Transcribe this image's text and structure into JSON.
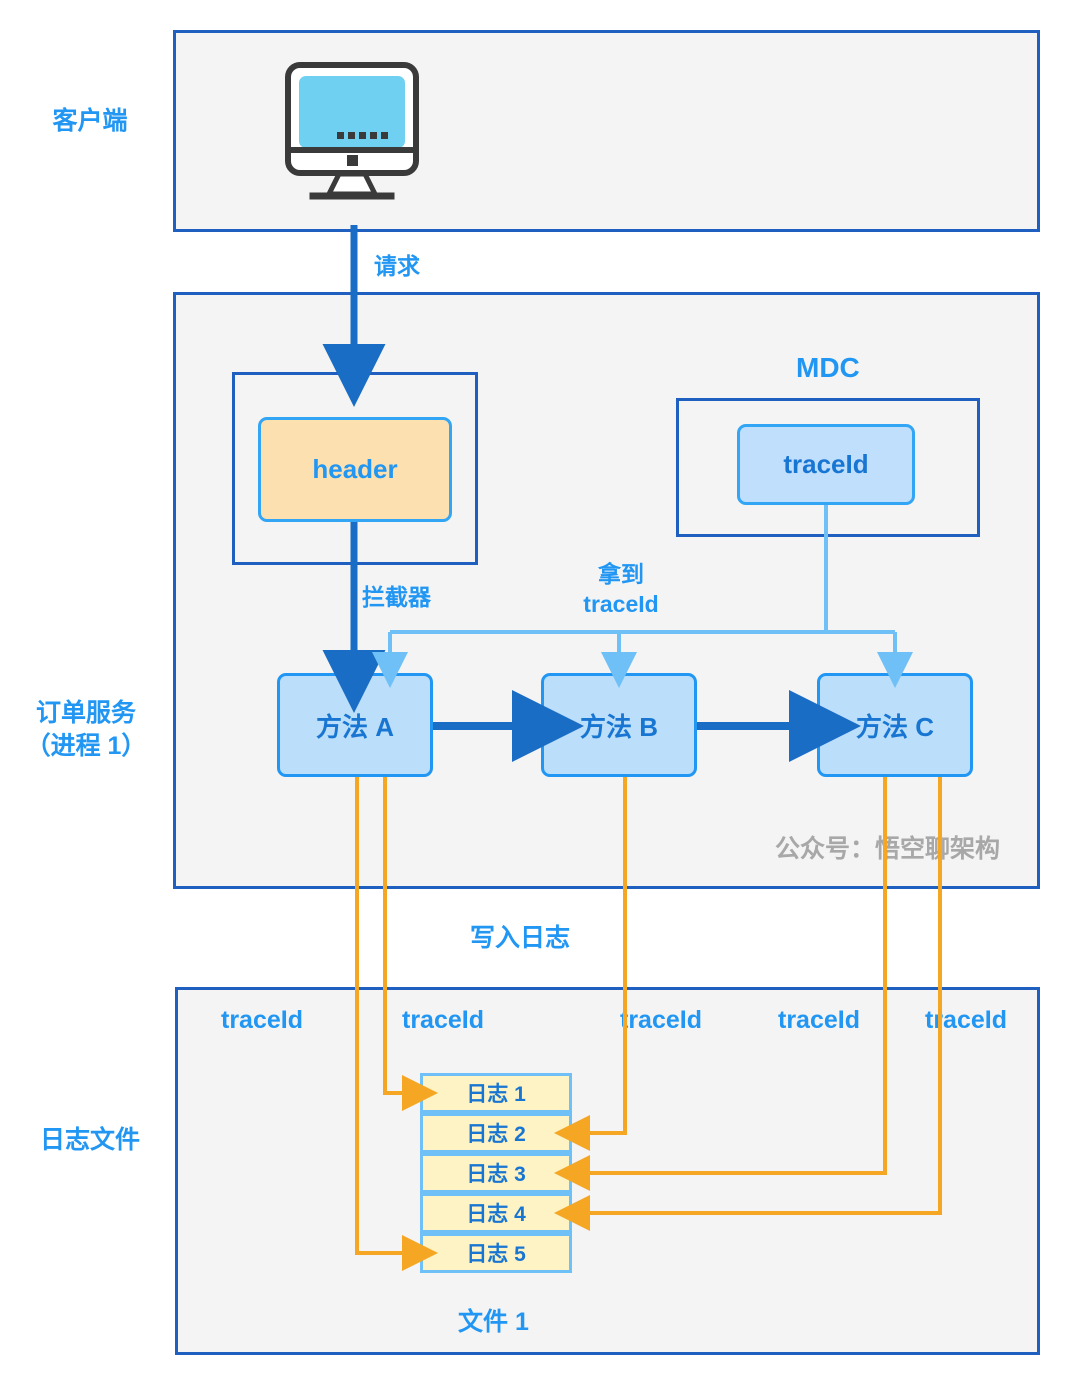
{
  "diagram": {
    "title": "MDC traceId logging flow",
    "colors": {
      "accent_blue": "#2196f3",
      "panel_border": "#1f5fbf",
      "panel_fill": "#f4f4f4",
      "node_blue_fill": "#bbdefb",
      "node_orange_fill": "#fde0b0",
      "log_fill": "#fdf3c4",
      "orange_line": "#f5a623",
      "dark_arrow": "#1a6dc4",
      "watermark_gray": "#a8a8a8"
    }
  },
  "lanes": [
    {
      "id": "client",
      "label": "客户端"
    },
    {
      "id": "order-service",
      "label_line1": "订单服务",
      "label_line2": "（进程 1）"
    },
    {
      "id": "log-file",
      "label": "日志文件"
    }
  ],
  "client_panel": {
    "icon": "monitor-icon"
  },
  "service_panel": {
    "mdc_title": "MDC",
    "header_node": "header",
    "mdc_traceid_node": "traceId",
    "methods": [
      {
        "id": "a",
        "label": "方法 A"
      },
      {
        "id": "b",
        "label": "方法 B"
      },
      {
        "id": "c",
        "label": "方法 C"
      }
    ],
    "watermark": "公众号：悟空聊架构"
  },
  "edge_labels": {
    "request": "请求",
    "interceptor": "拦截器",
    "get_traceid_line1": "拿到",
    "get_traceid_line2": "traceId",
    "write_log": "写入日志"
  },
  "log_panel": {
    "trace_tags": [
      "traceId",
      "traceId",
      "traceId",
      "traceId",
      "traceId"
    ],
    "logs": [
      {
        "id": "log1",
        "label": "日志 1"
      },
      {
        "id": "log2",
        "label": "日志 2"
      },
      {
        "id": "log3",
        "label": "日志 3"
      },
      {
        "id": "log4",
        "label": "日志 4"
      },
      {
        "id": "log5",
        "label": "日志 5"
      }
    ],
    "file_label": "文件 1"
  }
}
